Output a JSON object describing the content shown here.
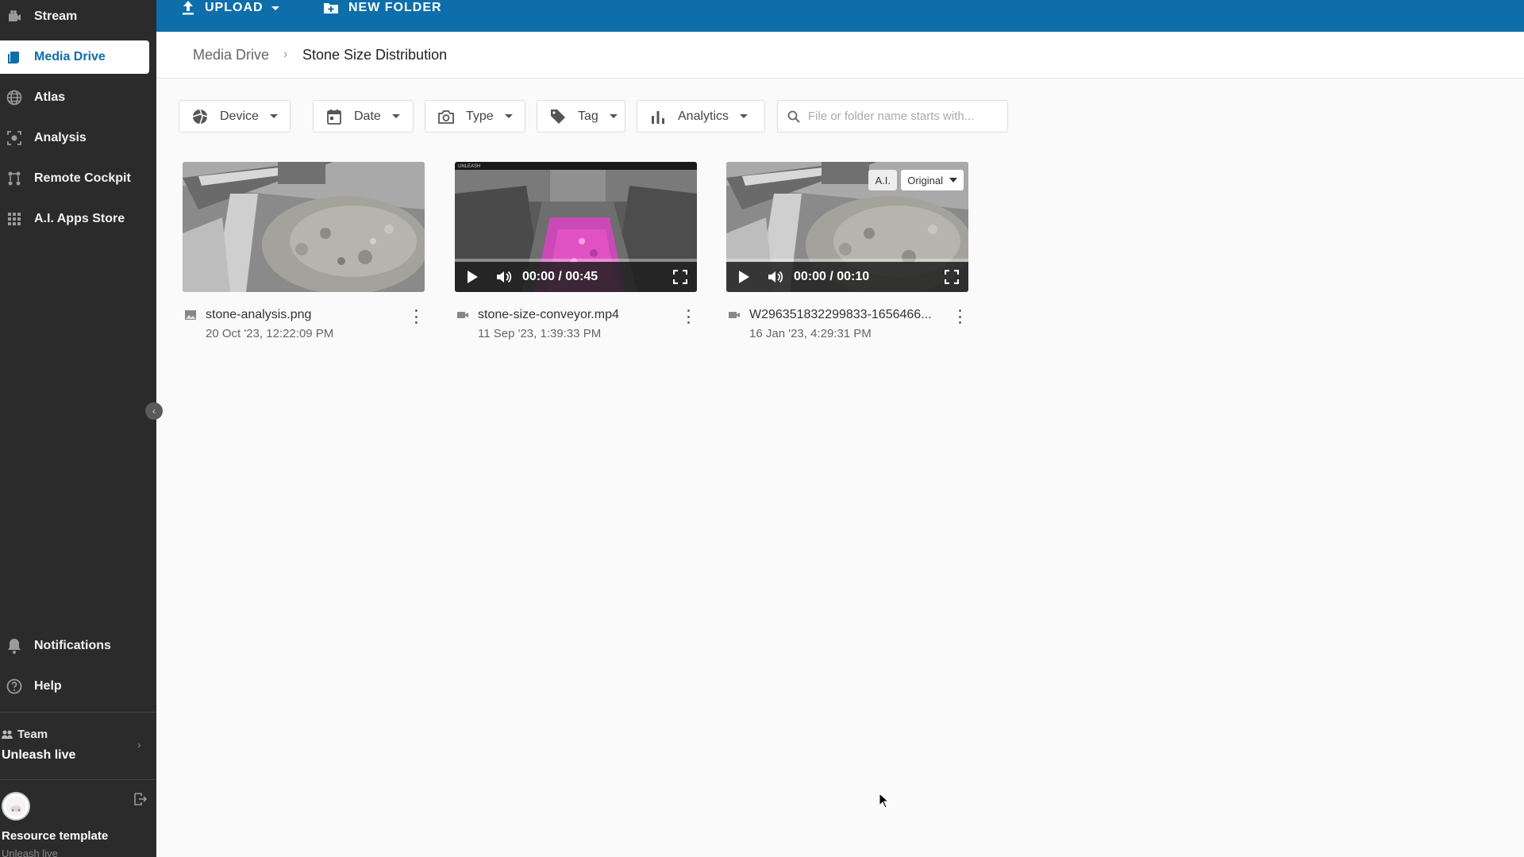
{
  "sidebar": {
    "items": [
      {
        "label": "Stream",
        "icon": "stream-icon"
      },
      {
        "label": "Media Drive",
        "icon": "media-drive-icon",
        "active": true
      },
      {
        "label": "Atlas",
        "icon": "globe-icon"
      },
      {
        "label": "Analysis",
        "icon": "analysis-icon"
      },
      {
        "label": "Remote Cockpit",
        "icon": "remote-cockpit-icon"
      },
      {
        "label": "A.I. Apps Store",
        "icon": "grid-icon"
      }
    ],
    "bottom_items": [
      {
        "label": "Notifications",
        "icon": "bell-icon"
      },
      {
        "label": "Help",
        "icon": "help-icon"
      }
    ],
    "team": {
      "label": "Team",
      "name": "Unleash live"
    },
    "user": {
      "name": "Resource template",
      "org": "Unleash live"
    }
  },
  "topbar": {
    "upload_label": "UPLOAD",
    "new_folder_label": "NEW FOLDER",
    "color": "#0d6eaa"
  },
  "breadcrumb": {
    "root": "Media Drive",
    "separator": "›",
    "current": "Stone Size Distribution"
  },
  "filters": [
    {
      "label": "Device",
      "icon": "device-icon"
    },
    {
      "label": "Date",
      "icon": "calendar-icon"
    },
    {
      "label": "Type",
      "icon": "camera-icon"
    },
    {
      "label": "Tag",
      "icon": "tag-icon"
    },
    {
      "label": "Analytics",
      "icon": "bar-chart-icon"
    }
  ],
  "search": {
    "placeholder": "File or folder name starts with...",
    "value": ""
  },
  "files": [
    {
      "name": "stone-analysis.png",
      "date": "20 Oct '23, 12:22:09 PM",
      "type": "image"
    },
    {
      "name": "stone-size-conveyor.mp4",
      "date": "11 Sep '23, 1:39:33 PM",
      "type": "video",
      "time": "00:00 / 00:45",
      "progress": 0
    },
    {
      "name": "W296351832299833-1656466...",
      "date": "16 Jan '23, 4:29:31 PM",
      "type": "video",
      "time": "00:00 / 00:10",
      "progress": 0,
      "ai_badge": "A.I.",
      "view_select": "Original"
    }
  ]
}
